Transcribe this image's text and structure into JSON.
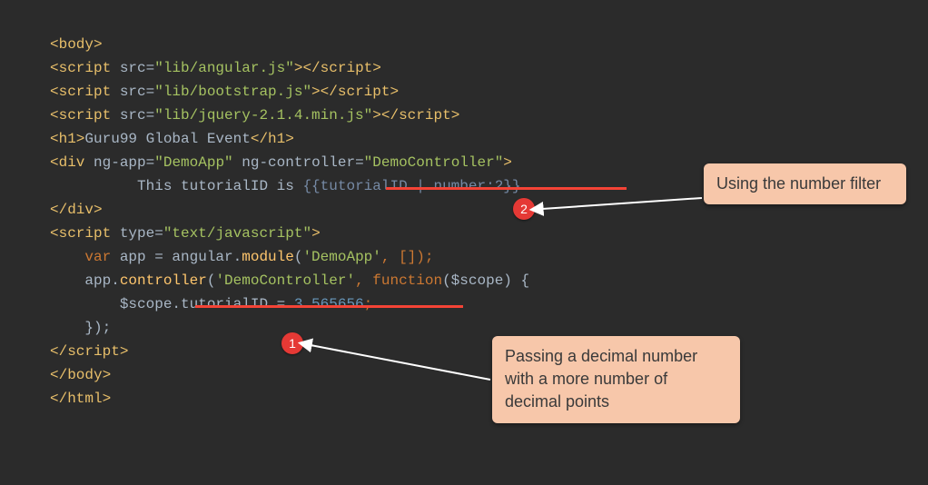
{
  "code": {
    "l1": "<body>",
    "l2a": "<script ",
    "l2b": "src=",
    "l2c": "\"lib/angular.js\"",
    "l2d": "></",
    "l2e": "script",
    "l2f": ">",
    "l3a": "<script ",
    "l3b": "src=",
    "l3c": "\"lib/bootstrap.js\"",
    "l3d": "></",
    "l3e": "script",
    "l3f": ">",
    "l4a": "<script ",
    "l4b": "src=",
    "l4c": "\"lib/jquery-2.1.4.min.js\"",
    "l4d": "></",
    "l4e": "script",
    "l4f": ">",
    "l5a": "<h1>",
    "l5b": "Guru99 Global Event",
    "l5c": "</h1>",
    "l6a": "<div ",
    "l6b": "ng-app=",
    "l6c": "\"DemoApp\" ",
    "l6d": "ng-controller=",
    "l6e": "\"DemoController\"",
    "l6f": ">",
    "l7a": "          This tutorialID is ",
    "l7b": "{{tutorialID | number:2}}",
    "l8": "</div>",
    "l9a": "<script ",
    "l9b": "type=",
    "l9c": "\"text/javascript\"",
    "l9d": ">",
    "l10a": "    var ",
    "l10b": "app = angular.",
    "l10c": "module",
    "l10d": "(",
    "l10e": "'DemoApp'",
    "l10f": ", []);",
    "l11a": "    app.",
    "l11b": "controller",
    "l11c": "(",
    "l11d": "'DemoController'",
    "l11e": ", ",
    "l11f": "function",
    "l11g": "($scope) {",
    "l12a": "        $scope.tutorialID = ",
    "l12b": "3.565656",
    "l12c": ";",
    "l13": "    });",
    "l14a": "</",
    "l14b": "script",
    "l14c": ">",
    "l15": "</body>",
    "l16": "</html>"
  },
  "badges": {
    "one": "1",
    "two": "2"
  },
  "callouts": {
    "top": "Using the number filter",
    "bottom": "Passing a decimal number with a more number of decimal points"
  }
}
